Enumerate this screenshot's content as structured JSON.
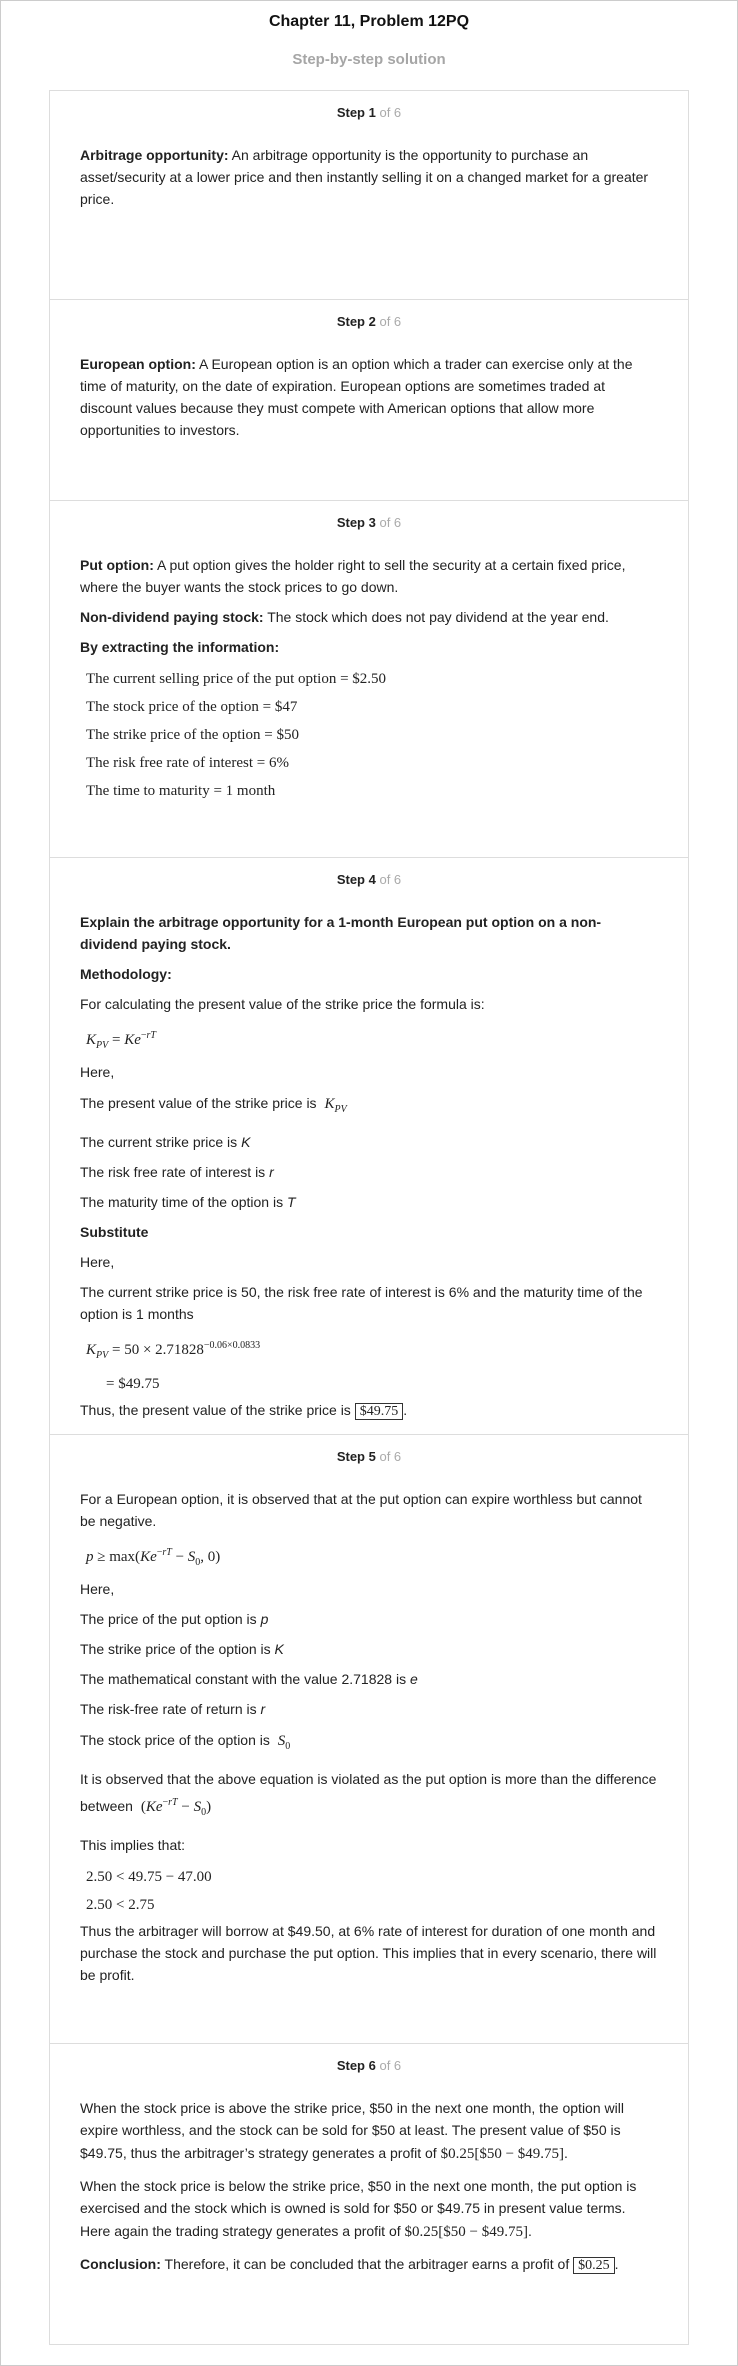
{
  "title": "Chapter 11, Problem 12PQ",
  "subtitle": "Step-by-step solution",
  "of_total": "of 6",
  "steps": [
    {
      "label": "Step 1",
      "term": "Arbitrage opportunity:",
      "text": " An arbitrage opportunity is the opportunity to purchase an asset/security at a lower price and then instantly selling it on a changed market for a greater price."
    },
    {
      "label": "Step 2",
      "term": "European option:",
      "text": " A European option is an option which a trader can exercise only at the time of maturity, on the date of expiration. European options are sometimes traded at discount values because they must compete with American options that allow more opportunities to investors."
    },
    {
      "label": "Step 3",
      "put_term": "Put option:",
      "put_text": " A put option gives the holder right to sell the security at a certain fixed price, where the buyer wants the stock prices to go down.",
      "nd_term": "Non-dividend paying stock:",
      "nd_text": " The stock which does not pay dividend at the year end.",
      "extract_heading": "By extracting the information:",
      "info": [
        "The current selling price of the put option = $2.50",
        "The stock price of the option = $47",
        "The strike price of the option = $50",
        "The risk free rate of interest = 6%",
        "The time to maturity = 1 month"
      ]
    },
    {
      "label": "Step 4",
      "heading": "Explain the arbitrage opportunity for a 1-month European put option on a non-dividend paying stock.",
      "methodology": "Methodology:",
      "formula_intro": "For calculating the present value of the strike price the formula is:",
      "here": "Here,",
      "def_pv": "The present value of the strike price is",
      "def_k": "The current strike price is",
      "def_r": "The risk free rate of interest is",
      "def_t": "The maturity time of the option is",
      "substitute": "Substitute",
      "here2": "Here,",
      "given": "The current strike price is 50, the risk free rate of interest is 6% and the maturity time of the option is 1 months",
      "calc_line1": "= 50 × 2.71828",
      "calc_exp": "−0.06×0.0833",
      "calc_line2": "= $49.75",
      "result_text": "Thus, the present value of the strike price is",
      "result_value": "$49.75"
    },
    {
      "label": "Step 5",
      "intro": "For a European option, it is observed that at the put option can expire worthless but cannot be negative.",
      "here": "Here,",
      "def_p": "The price of the put option is",
      "def_k": "The strike price of the option is",
      "def_e": "The mathematical constant with the value 2.71828 is",
      "def_r": "The risk-free rate of return is",
      "def_s": "The stock price of the option is",
      "violated": "It is observed that the above equation is violated as the put option is more than the difference between",
      "implies": "This implies that:",
      "ineq1": "2.50 < 49.75 − 47.00",
      "ineq2": "2.50 < 2.75",
      "conclusion": "Thus the arbitrager will borrow at $49.50, at 6% rate of interest for duration of one month and purchase the stock and purchase the put option. This implies that in every scenario, there will be profit."
    },
    {
      "label": "Step 6",
      "para1": "When the stock price is above the strike price, $50 in the next one month, the option will expire worthless, and the stock can be sold for $50 at least. The present value of $50 is $49.75, thus the arbitrager’s strategy generates a profit of",
      "para2": "When the stock price is below the strike price, $50 in the next one month, the put option is exercised and the stock which is owned is sold for $50 or $49.75 in present value terms. Here again the trading strategy generates a profit of",
      "profit_expr": "$0.25[$50 − $49.75]",
      "concl_term": "Conclusion:",
      "concl_text": " Therefore, it can be concluded that the arbitrager earns a profit of",
      "concl_value": "$0.25"
    }
  ]
}
